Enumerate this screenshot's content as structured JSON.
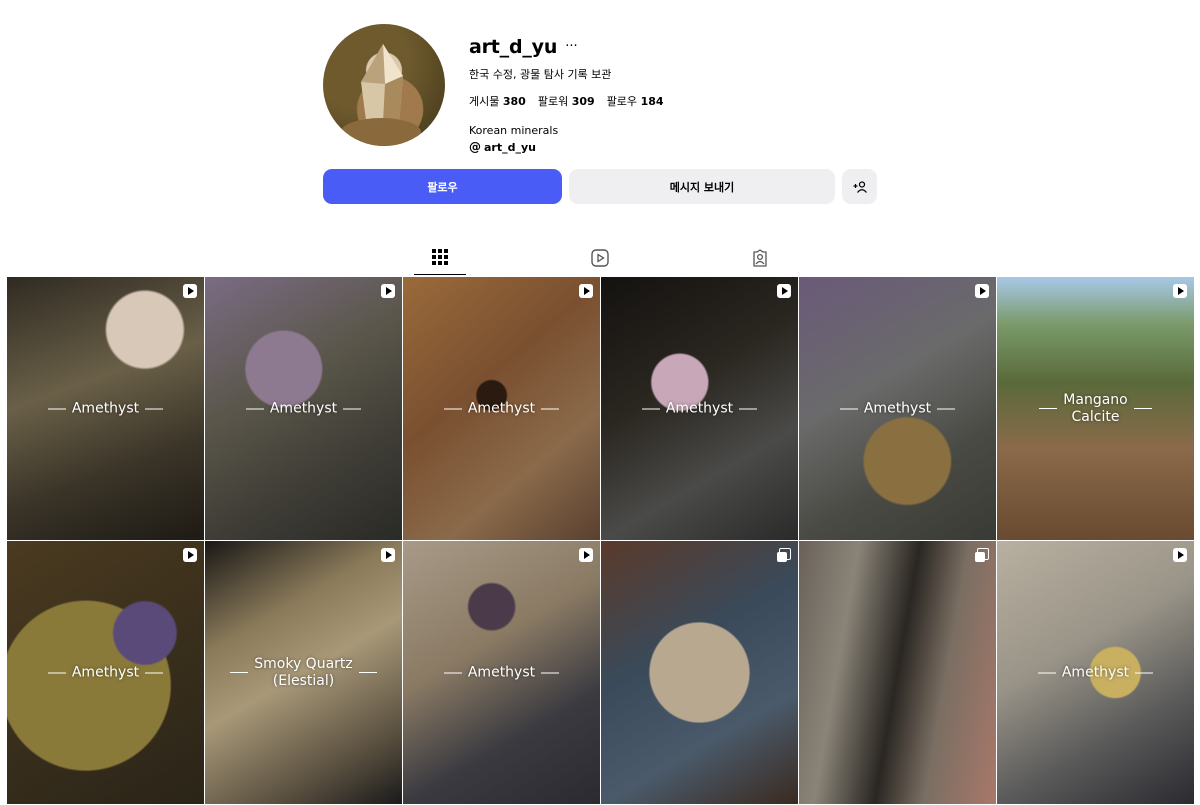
{
  "profile": {
    "username": "art_d_yu",
    "more_label": "···",
    "bio": "한국 수정, 광물 탐사 기록 보관",
    "stats": {
      "posts_label": "게시물",
      "posts_count": "380",
      "followers_label": "팔로워",
      "followers_count": "309",
      "following_label": "팔로우",
      "following_count": "184"
    },
    "description": "Korean minerals",
    "threads_handle": "art_d_yu",
    "threads_icon": "threads-icon"
  },
  "actions": {
    "follow_label": "팔로우",
    "message_label": "메시지 보내기",
    "suggest_icon": "add-person-icon",
    "accent": "#4a5cf6"
  },
  "tabs": [
    {
      "name": "posts",
      "icon": "grid-icon",
      "active": true
    },
    {
      "name": "reels",
      "icon": "reels-icon",
      "active": false
    },
    {
      "name": "tagged",
      "icon": "tagged-icon",
      "active": false
    }
  ],
  "posts": [
    {
      "label": "Amethyst",
      "badge": "reel"
    },
    {
      "label": "Amethyst",
      "badge": "reel"
    },
    {
      "label": "Amethyst",
      "badge": "reel"
    },
    {
      "label": "Amethyst",
      "badge": "reel"
    },
    {
      "label": "Amethyst",
      "badge": "reel"
    },
    {
      "label": "Mangano\nCalcite",
      "badge": "reel"
    },
    {
      "label": "Amethyst",
      "badge": "reel"
    },
    {
      "label": "Smoky Quartz\n(Elestial)",
      "badge": "reel"
    },
    {
      "label": "Amethyst",
      "badge": "reel"
    },
    {
      "label": "",
      "badge": "carousel"
    },
    {
      "label": "",
      "badge": "carousel"
    },
    {
      "label": "Amethyst",
      "badge": "reel"
    }
  ]
}
